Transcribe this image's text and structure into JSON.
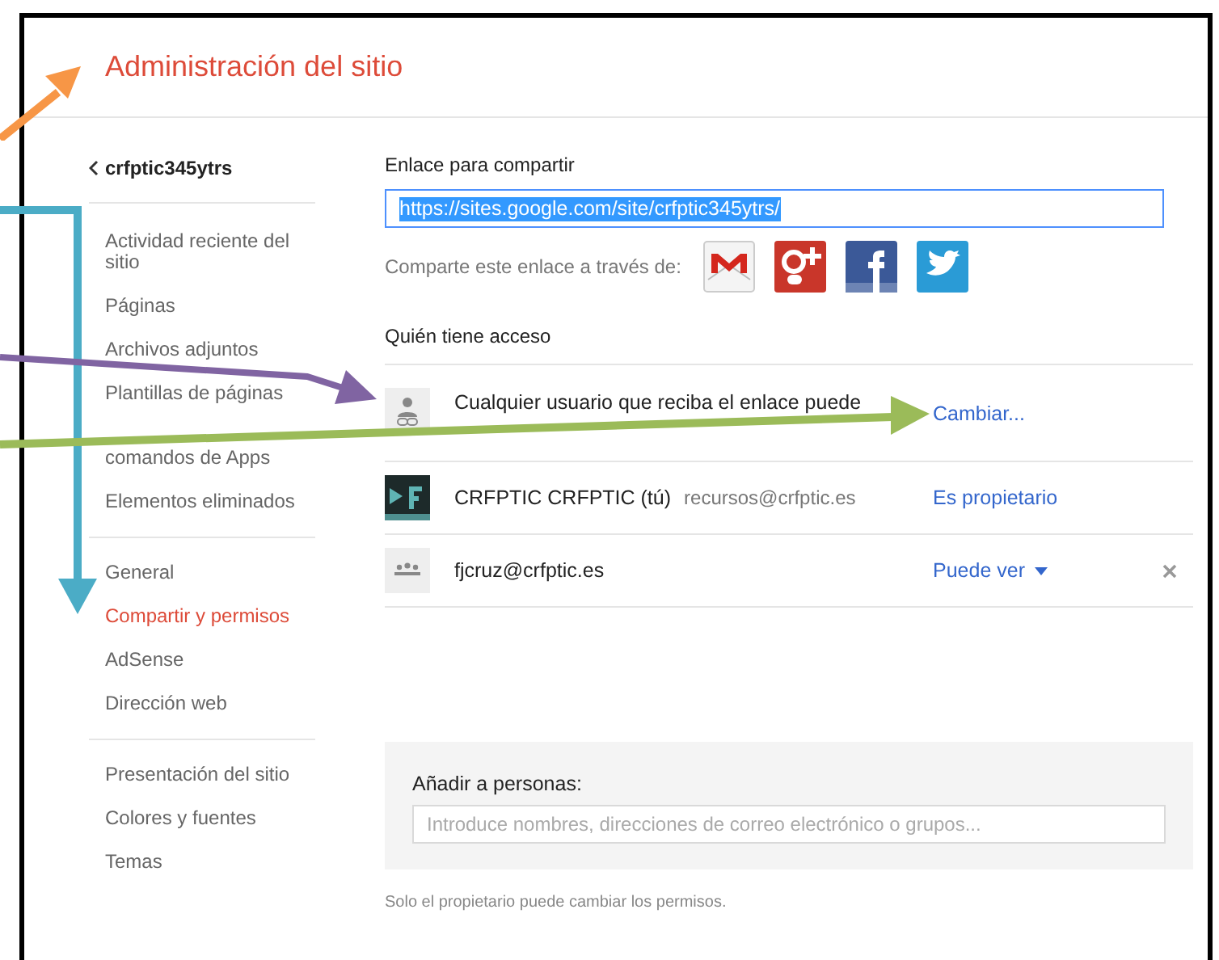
{
  "header": {
    "title": "Administración del sitio"
  },
  "sidebar": {
    "site_name": "crfptic345ytrs",
    "groups": [
      [
        {
          "label": "Actividad reciente del sitio",
          "selected": false
        },
        {
          "label": "Páginas",
          "selected": false
        },
        {
          "label": "Archivos adjuntos",
          "selected": false
        },
        {
          "label": "Plantillas de páginas",
          "selected": false
        },
        {
          "label": "comandos de Apps",
          "selected": false
        },
        {
          "label": "Elementos eliminados",
          "selected": false
        }
      ],
      [
        {
          "label": "General",
          "selected": false
        },
        {
          "label": "Compartir y permisos",
          "selected": true
        },
        {
          "label": "AdSense",
          "selected": false
        },
        {
          "label": "Dirección web",
          "selected": false
        }
      ],
      [
        {
          "label": "Presentación del sitio",
          "selected": false
        },
        {
          "label": "Colores y fuentes",
          "selected": false
        },
        {
          "label": "Temas",
          "selected": false
        }
      ]
    ]
  },
  "share_link": {
    "label": "Enlace para compartir",
    "value": "https://sites.google.com/site/crfptic345ytrs/",
    "share_via": "Comparte este enlace a través de:",
    "services": [
      {
        "kind": "mail"
      },
      {
        "kind": "gplus"
      },
      {
        "kind": "facebook"
      },
      {
        "kind": "twitter"
      }
    ]
  },
  "access": {
    "heading": "Quién tiene acceso",
    "entries": [
      {
        "kind": "link",
        "name": "Cualquier usuario que reciba el enlace puede",
        "action": "Cambiar..."
      },
      {
        "kind": "owner",
        "name": "CRFPTIC CRFPTIC (tú)",
        "email": "recursos@crfptic.es",
        "action": "Es propietario"
      },
      {
        "kind": "group",
        "name": "fjcruz@crfptic.es",
        "action": "Puede ver",
        "removable": true
      }
    ]
  },
  "add_people": {
    "label": "Añadir a personas:",
    "placeholder": "Introduce nombres, direcciones de correo electrónico o grupos..."
  },
  "footer_note": "Solo el propietario puede cambiar los permisos."
}
